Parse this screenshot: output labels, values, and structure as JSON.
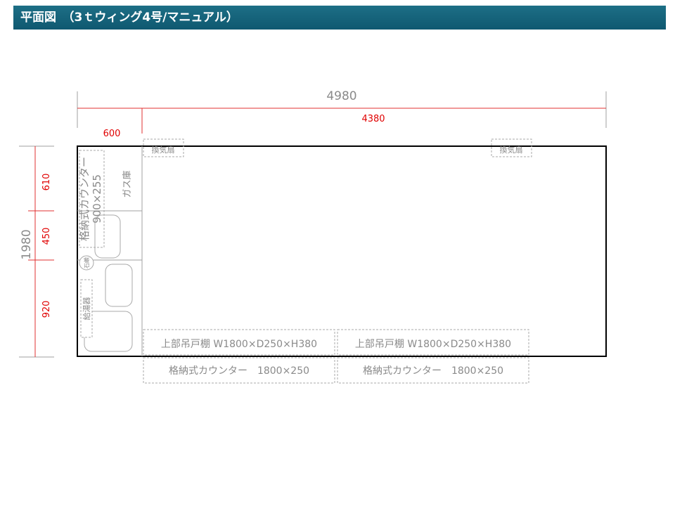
{
  "header": {
    "title": "平面図　（3ｔウィング4号/マニュアル）"
  },
  "dimensions": {
    "total_length": "4980",
    "cargo_length": "4380",
    "front_section": "600",
    "total_width": "1980",
    "section_a": "610",
    "section_b": "450",
    "section_c": "920"
  },
  "fixtures": {
    "fan_left": "換気扇",
    "fan_right": "換気扇",
    "storage_counter_side": "格納式カウンター",
    "storage_counter_side_size": "900×255",
    "gas_storage": "ガス庫",
    "sink": "石鹸",
    "water_heater": "給湯器",
    "upper_cabinet_1": "上部吊戸棚 W1800×D250×H380",
    "upper_cabinet_2": "上部吊戸棚 W1800×D250×H380",
    "storage_counter_1": "格納式カウンター　1800×250",
    "storage_counter_2": "格納式カウンター　1800×250"
  },
  "colors": {
    "header": "#16647c",
    "dimension_red": "#e00000",
    "outline": "#000000",
    "fixture": "#a0a0a0"
  }
}
